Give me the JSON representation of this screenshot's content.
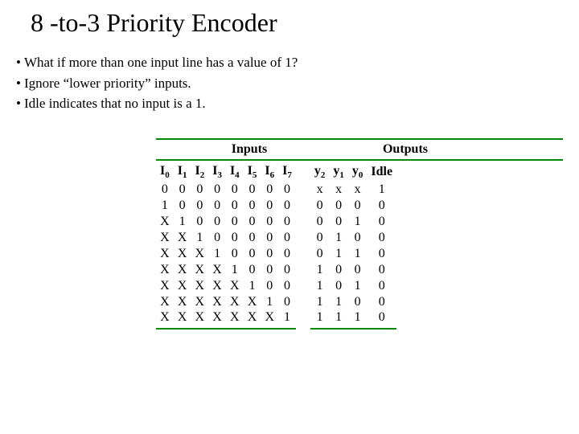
{
  "title": "8 -to-3  Priority Encoder",
  "bullets": [
    "What if more than one input line has a value of  1?",
    "Ignore “lower priority” inputs.",
    "Idle indicates that no input is a 1."
  ],
  "table": {
    "section_inputs": "Inputs",
    "section_outputs": "Outputs",
    "input_headers": [
      {
        "main": "I",
        "sub": "0"
      },
      {
        "main": "I",
        "sub": "1"
      },
      {
        "main": "I",
        "sub": "2"
      },
      {
        "main": "I",
        "sub": "3"
      },
      {
        "main": "I",
        "sub": "4"
      },
      {
        "main": "I",
        "sub": "5"
      },
      {
        "main": "I",
        "sub": "6"
      },
      {
        "main": "I",
        "sub": "7"
      }
    ],
    "output_headers": [
      {
        "main": "y",
        "sub": "2"
      },
      {
        "main": "y",
        "sub": "1"
      },
      {
        "main": "y",
        "sub": "0"
      },
      {
        "main": "Idle",
        "sub": ""
      }
    ],
    "rows": [
      {
        "in": [
          "0",
          "0",
          "0",
          "0",
          "0",
          "0",
          "0",
          "0"
        ],
        "out": [
          "x",
          "x",
          "x",
          "1"
        ]
      },
      {
        "in": [
          "1",
          "0",
          "0",
          "0",
          "0",
          "0",
          "0",
          "0"
        ],
        "out": [
          "0",
          "0",
          "0",
          "0"
        ]
      },
      {
        "in": [
          "X",
          "1",
          "0",
          "0",
          "0",
          "0",
          "0",
          "0"
        ],
        "out": [
          "0",
          "0",
          "1",
          "0"
        ]
      },
      {
        "in": [
          "X",
          "X",
          "1",
          "0",
          "0",
          "0",
          "0",
          "0"
        ],
        "out": [
          "0",
          "1",
          "0",
          "0"
        ]
      },
      {
        "in": [
          "X",
          "X",
          "X",
          "1",
          "0",
          "0",
          "0",
          "0"
        ],
        "out": [
          "0",
          "1",
          "1",
          "0"
        ]
      },
      {
        "in": [
          "X",
          "X",
          "X",
          "X",
          "1",
          "0",
          "0",
          "0"
        ],
        "out": [
          "1",
          "0",
          "0",
          "0"
        ]
      },
      {
        "in": [
          "X",
          "X",
          "X",
          "X",
          "X",
          "1",
          "0",
          "0"
        ],
        "out": [
          "1",
          "0",
          "1",
          "0"
        ]
      },
      {
        "in": [
          "X",
          "X",
          "X",
          "X",
          "X",
          "X",
          "1",
          "0"
        ],
        "out": [
          "1",
          "1",
          "0",
          "0"
        ]
      },
      {
        "in": [
          "X",
          "X",
          "X",
          "X",
          "X",
          "X",
          "X",
          "1"
        ],
        "out": [
          "1",
          "1",
          "1",
          "0"
        ]
      }
    ]
  }
}
